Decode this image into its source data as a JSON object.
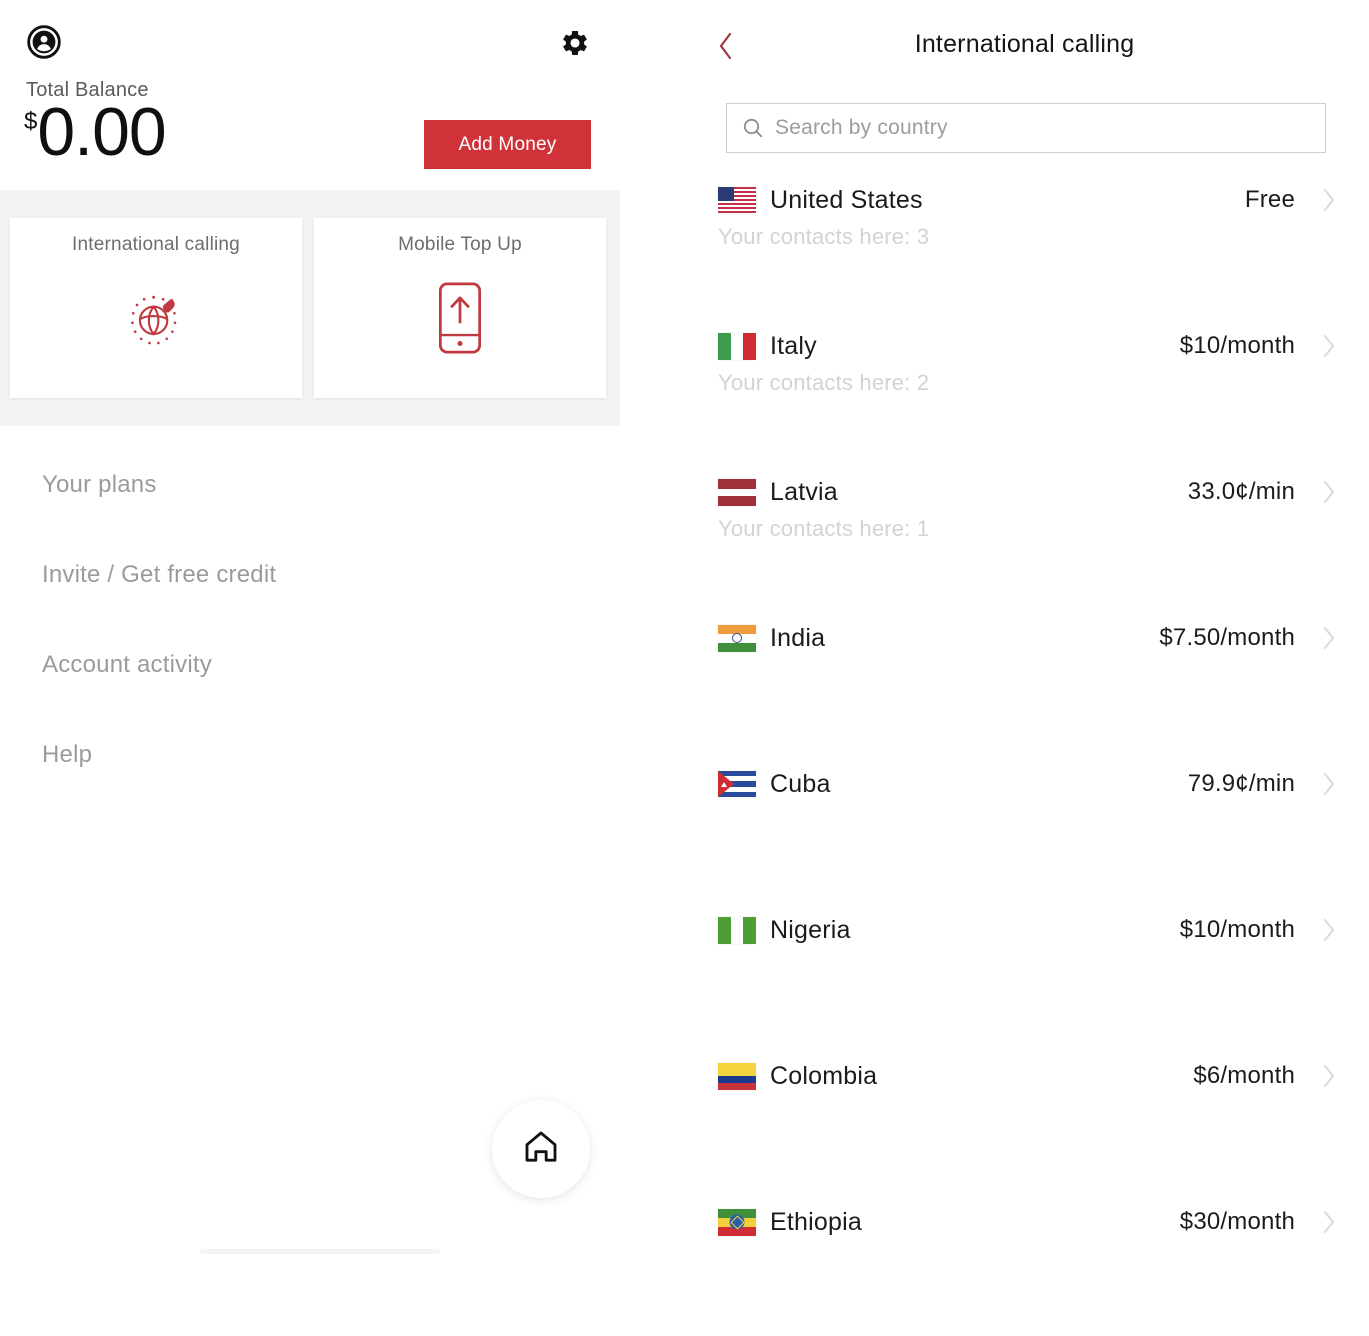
{
  "left_panel": {
    "icons": {
      "account": "account-circle-icon",
      "settings": "gear-icon",
      "home": "home-icon"
    },
    "balance": {
      "label": "Total Balance",
      "currency_symbol": "$",
      "amount": "0.00"
    },
    "add_money_label": "Add Money",
    "cards": [
      {
        "title": "International calling",
        "icon": "globe-phone-icon"
      },
      {
        "title": "Mobile Top Up",
        "icon": "phone-up-arrow-icon"
      }
    ],
    "menu": [
      {
        "label": "Your plans"
      },
      {
        "label": "Invite / Get free credit"
      },
      {
        "label": "Account activity"
      },
      {
        "label": "Help"
      }
    ]
  },
  "right_panel": {
    "title": "International calling",
    "back_icon": "chevron-left-icon",
    "search": {
      "icon": "search-icon",
      "placeholder": "Search by country",
      "value": ""
    },
    "countries": [
      {
        "name": "United States",
        "price": "Free",
        "contacts": "Your contacts here: 3",
        "flag": "us"
      },
      {
        "name": "Italy",
        "price": "$10/month",
        "contacts": "Your contacts here: 2",
        "flag": "it"
      },
      {
        "name": "Latvia",
        "price": "33.0¢/min",
        "contacts": "Your contacts here: 1",
        "flag": "lv"
      },
      {
        "name": "India",
        "price": "$7.50/month",
        "contacts": "",
        "flag": "in"
      },
      {
        "name": "Cuba",
        "price": "79.9¢/min",
        "contacts": "",
        "flag": "cu"
      },
      {
        "name": "Nigeria",
        "price": "$10/month",
        "contacts": "",
        "flag": "ng"
      },
      {
        "name": "Colombia",
        "price": "$6/month",
        "contacts": "",
        "flag": "co"
      },
      {
        "name": "Ethiopia",
        "price": "$30/month",
        "contacts": "",
        "flag": "et"
      }
    ]
  },
  "colors": {
    "brand_red": "#cf3339",
    "accent_maroon": "#9e3a44",
    "band_gray": "#f3f3f3",
    "muted_text": "#9b9b9b",
    "faint_text": "#d3d3d3"
  }
}
